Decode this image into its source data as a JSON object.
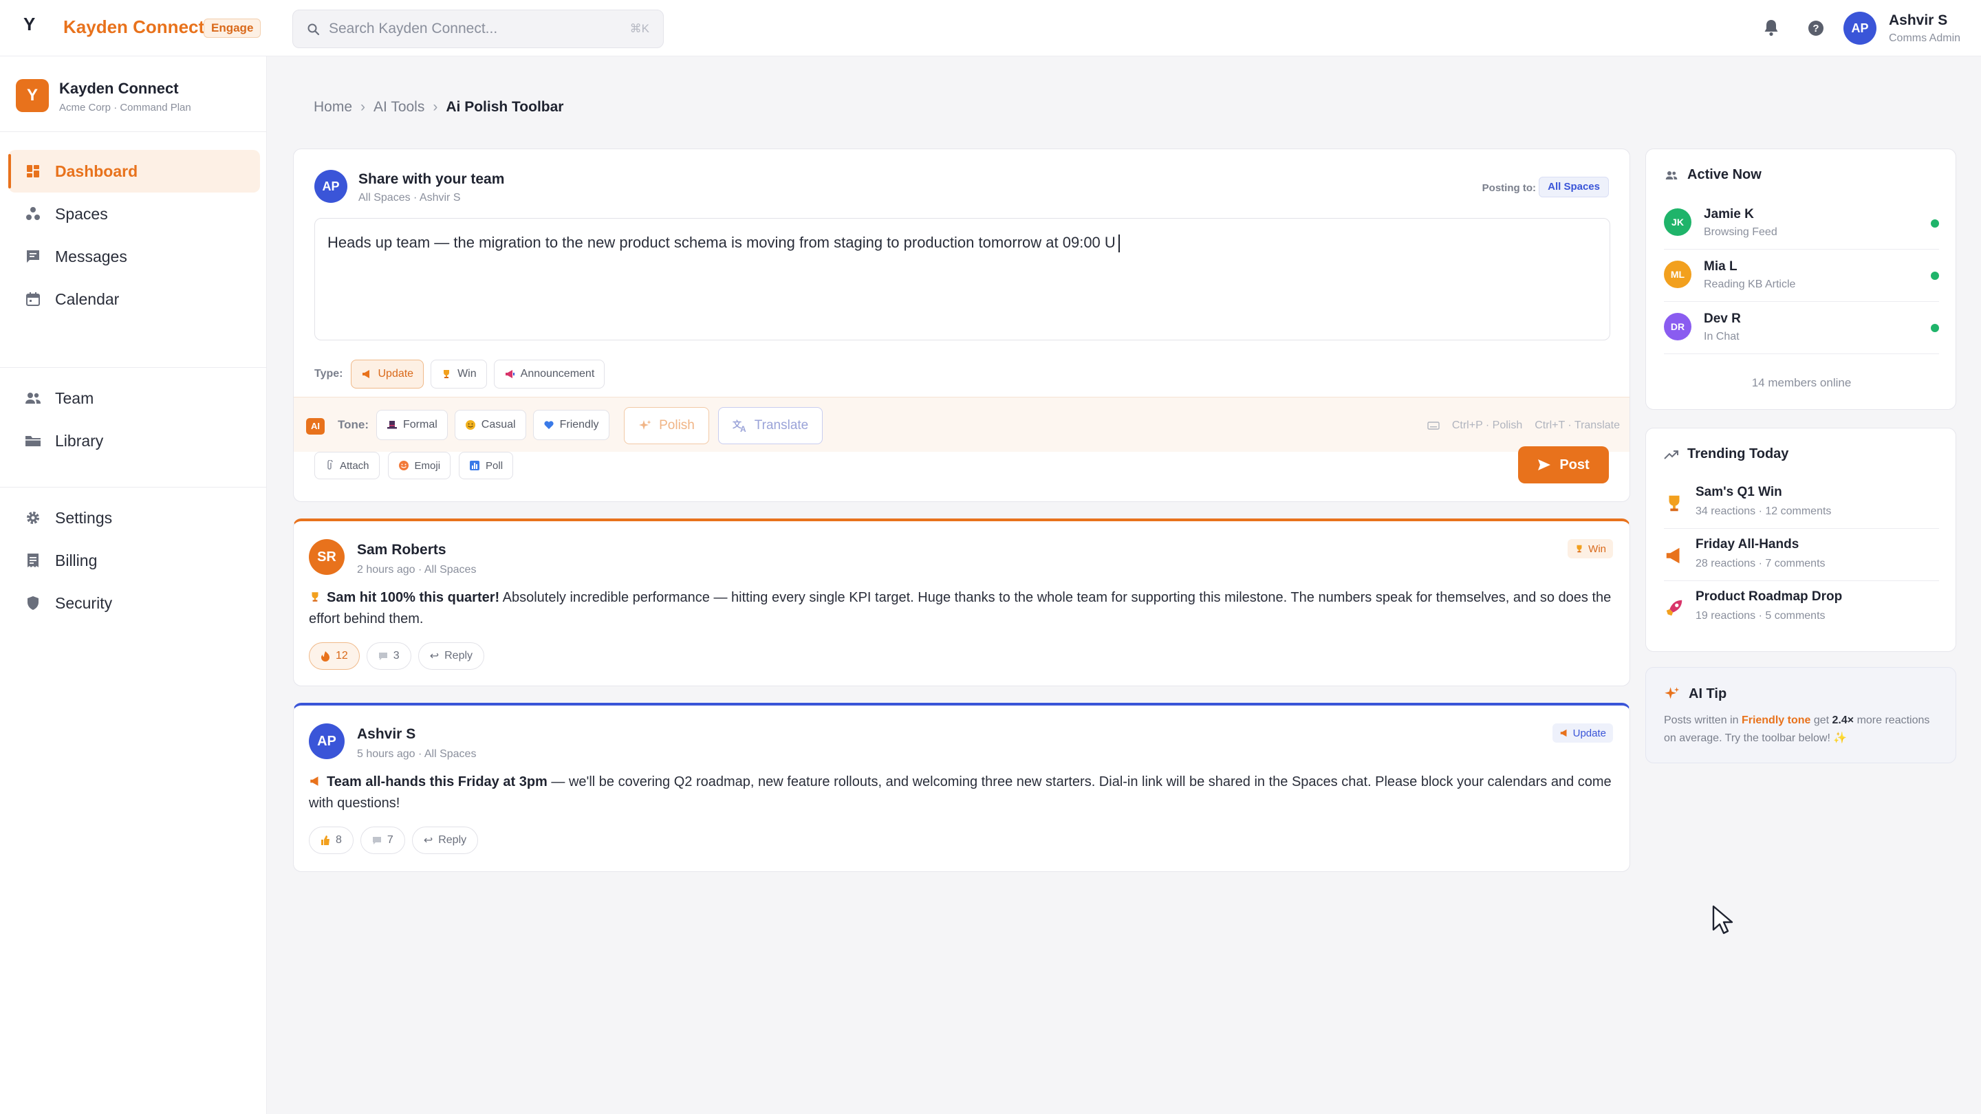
{
  "topbar": {
    "logo_mark": "Y",
    "brand": "Kayden Connect",
    "badge": "Engage",
    "search_placeholder": "Search Kayden Connect...",
    "search_shortcut": "⌘K",
    "user_initials": "AP",
    "user_name": "Ashvir S",
    "user_role": "Comms Admin"
  },
  "workspace": {
    "logo": "Y",
    "name": "Kayden Connect",
    "plan": "Acme Corp · Command Plan"
  },
  "sidebar": {
    "items": [
      {
        "label": "Dashboard",
        "icon": "dashboard-icon"
      },
      {
        "label": "Spaces",
        "icon": "spaces-icon"
      },
      {
        "label": "Messages",
        "icon": "message-icon"
      },
      {
        "label": "Calendar",
        "icon": "calendar-icon"
      },
      {
        "label": "Team",
        "icon": "team-icon"
      },
      {
        "label": "Library",
        "icon": "folder-icon"
      },
      {
        "label": "Settings",
        "icon": "gear-icon"
      },
      {
        "label": "Billing",
        "icon": "billing-icon"
      },
      {
        "label": "Security",
        "icon": "shield-icon"
      }
    ]
  },
  "breadcrumb": {
    "home": "Home",
    "section": "AI Tools",
    "current": "Ai Polish Toolbar"
  },
  "composer": {
    "initials": "AP",
    "title": "Share with your team",
    "subtitle": "All Spaces · Ashvir S",
    "posting_label": "Posting to:",
    "posting_target": "All Spaces",
    "text": "Heads up team — the migration to the new product schema is moving from staging to production tomorrow at 09:00 U",
    "type_label": "Type:",
    "types": [
      "Update",
      "Win",
      "Announcement"
    ],
    "ai_badge": "AI",
    "tone_label": "Tone:",
    "tones": [
      "Formal",
      "Casual",
      "Friendly"
    ],
    "polish_label": "Polish",
    "translate_label": "Translate",
    "shortcut_polish": "Ctrl+P · Polish",
    "shortcut_translate": "Ctrl+T · Translate",
    "attachments": [
      "Attach",
      "Emoji",
      "Poll"
    ],
    "post_label": "Post"
  },
  "posts": [
    {
      "initials": "SR",
      "author": "Sam Roberts",
      "meta": "2 hours ago · All Spaces",
      "tag": "Win",
      "headline": "Sam hit 100% this quarter!",
      "body": " Absolutely incredible performance — hitting every single KPI target. Huge thanks to the whole team for supporting this milestone. The numbers speak for themselves, and so does the effort behind them.",
      "reactions": "12",
      "comments": "3",
      "reply": "Reply",
      "accent": "#e8721c"
    },
    {
      "initials": "AP",
      "author": "Ashvir S",
      "meta": "5 hours ago · All Spaces",
      "tag": "Update",
      "headline": "Team all-hands this Friday at 3pm",
      "body": " — we'll be covering Q2 roadmap, new feature rollouts, and welcoming three new starters. Dial-in link will be shared in the Spaces chat. Please block your calendars and come with questions!",
      "reactions": "8",
      "comments": "7",
      "reply": "Reply",
      "accent": "#3a55d8"
    }
  ],
  "active_now": {
    "title": "Active Now",
    "people": [
      {
        "initials": "JK",
        "name": "Jamie K",
        "status": "Browsing Feed",
        "color": "#1fb46a"
      },
      {
        "initials": "ML",
        "name": "Mia L",
        "status": "Reading KB Article",
        "color": "#f2a01e"
      },
      {
        "initials": "DR",
        "name": "Dev R",
        "status": "In Chat",
        "color": "#8a5cf0"
      }
    ],
    "online": "14 members online"
  },
  "trending": {
    "title": "Trending Today",
    "items": [
      {
        "name": "Sam's Q1 Win",
        "stats": "34 reactions · 12 comments",
        "icon": "trophy-icon"
      },
      {
        "name": "Friday All-Hands",
        "stats": "28 reactions · 7 comments",
        "icon": "megaphone-icon"
      },
      {
        "name": "Product Roadmap Drop",
        "stats": "19 reactions · 5 comments",
        "icon": "rocket-icon"
      }
    ]
  },
  "ai_tip": {
    "title": "AI Tip",
    "pre": "Posts written in ",
    "highlight": "Friendly tone",
    "mid": " get ",
    "multiplier": "2.4×",
    "post": " more reactions on average. Try the toolbar below! ✨"
  },
  "colors": {
    "accent": "#e8721c",
    "blue": "#3a55d8",
    "online": "#1fb46a"
  }
}
